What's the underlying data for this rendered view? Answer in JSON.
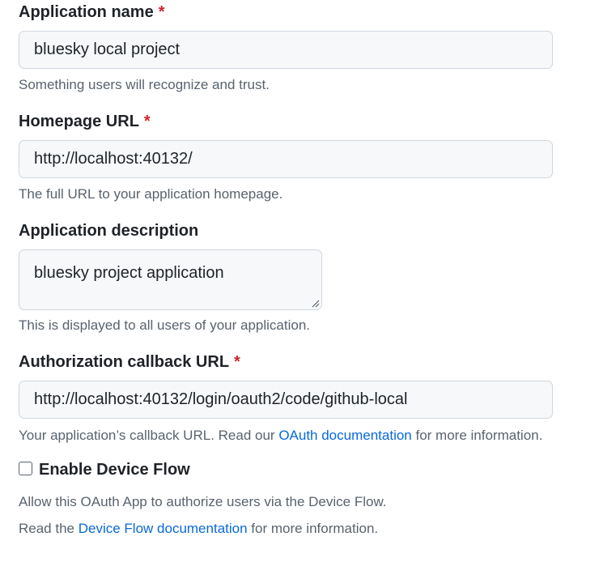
{
  "fields": {
    "app_name": {
      "label": "Application name",
      "required_mark": "*",
      "value": "bluesky local project",
      "note": "Something users will recognize and trust."
    },
    "homepage": {
      "label": "Homepage URL",
      "required_mark": "*",
      "value": "http://localhost:40132/",
      "note": "The full URL to your application homepage."
    },
    "description": {
      "label": "Application description",
      "value": "bluesky project application",
      "note": "This is displayed to all users of your application."
    },
    "callback": {
      "label": "Authorization callback URL",
      "required_mark": "*",
      "value": "http://localhost:40132/login/oauth2/code/github-local",
      "note_prefix": "Your application’s callback URL. Read our ",
      "note_link": "OAuth documentation",
      "note_suffix": " for more information."
    }
  },
  "device_flow": {
    "label": "Enable Device Flow",
    "checked": false,
    "note1": "Allow this OAuth App to authorize users via the Device Flow.",
    "note2_prefix": "Read the ",
    "note2_link": "Device Flow documentation",
    "note2_suffix": " for more information."
  },
  "colors": {
    "required": "#d1242f",
    "link": "#0969da",
    "input_bg": "#f6f8fa",
    "input_border": "#d0d7de",
    "muted": "#59636e"
  }
}
